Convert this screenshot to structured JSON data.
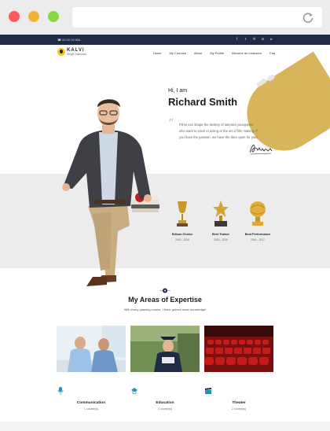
{
  "topbar": {
    "phone": "☎ 00 00 00 654",
    "social": [
      "f",
      "t",
      "℗",
      "in",
      "▸"
    ]
  },
  "logo": {
    "brand": "KALVI",
    "tagline": "Single Instructor"
  },
  "menu": [
    "Home",
    "My Courses",
    "About",
    "My Profile",
    "Become an Instructor",
    "Faq"
  ],
  "hero": {
    "greeting": "Hi, I am",
    "name": "Richard Smith",
    "quote_line1": "Films can shape the destiny of talented youngsters",
    "quote_line2": "who want to excel in acting or the art of film making. If",
    "quote_line3": "you have the passion, we have the door open for you!"
  },
  "awards": [
    {
      "label": "Edison Choice",
      "years": "2015 – 2016"
    },
    {
      "label": "Best Trainer",
      "years": "2015 – 2016"
    },
    {
      "label": "Best Performance",
      "years": "2016 – 2017"
    }
  ],
  "expertise": {
    "title": "My Areas of Expertise",
    "subtitle": "With every passing course, I have gained more knowledge!"
  },
  "courses": [
    {
      "title": "Communication",
      "count": "1 course(s)"
    },
    {
      "title": "Education",
      "count": "1 course(s)"
    },
    {
      "title": "Theater",
      "count": "2 course(s)"
    }
  ],
  "colors": {
    "accent": "#d8b55a",
    "navy": "#1f2b45",
    "grey_band": "#ececec"
  }
}
